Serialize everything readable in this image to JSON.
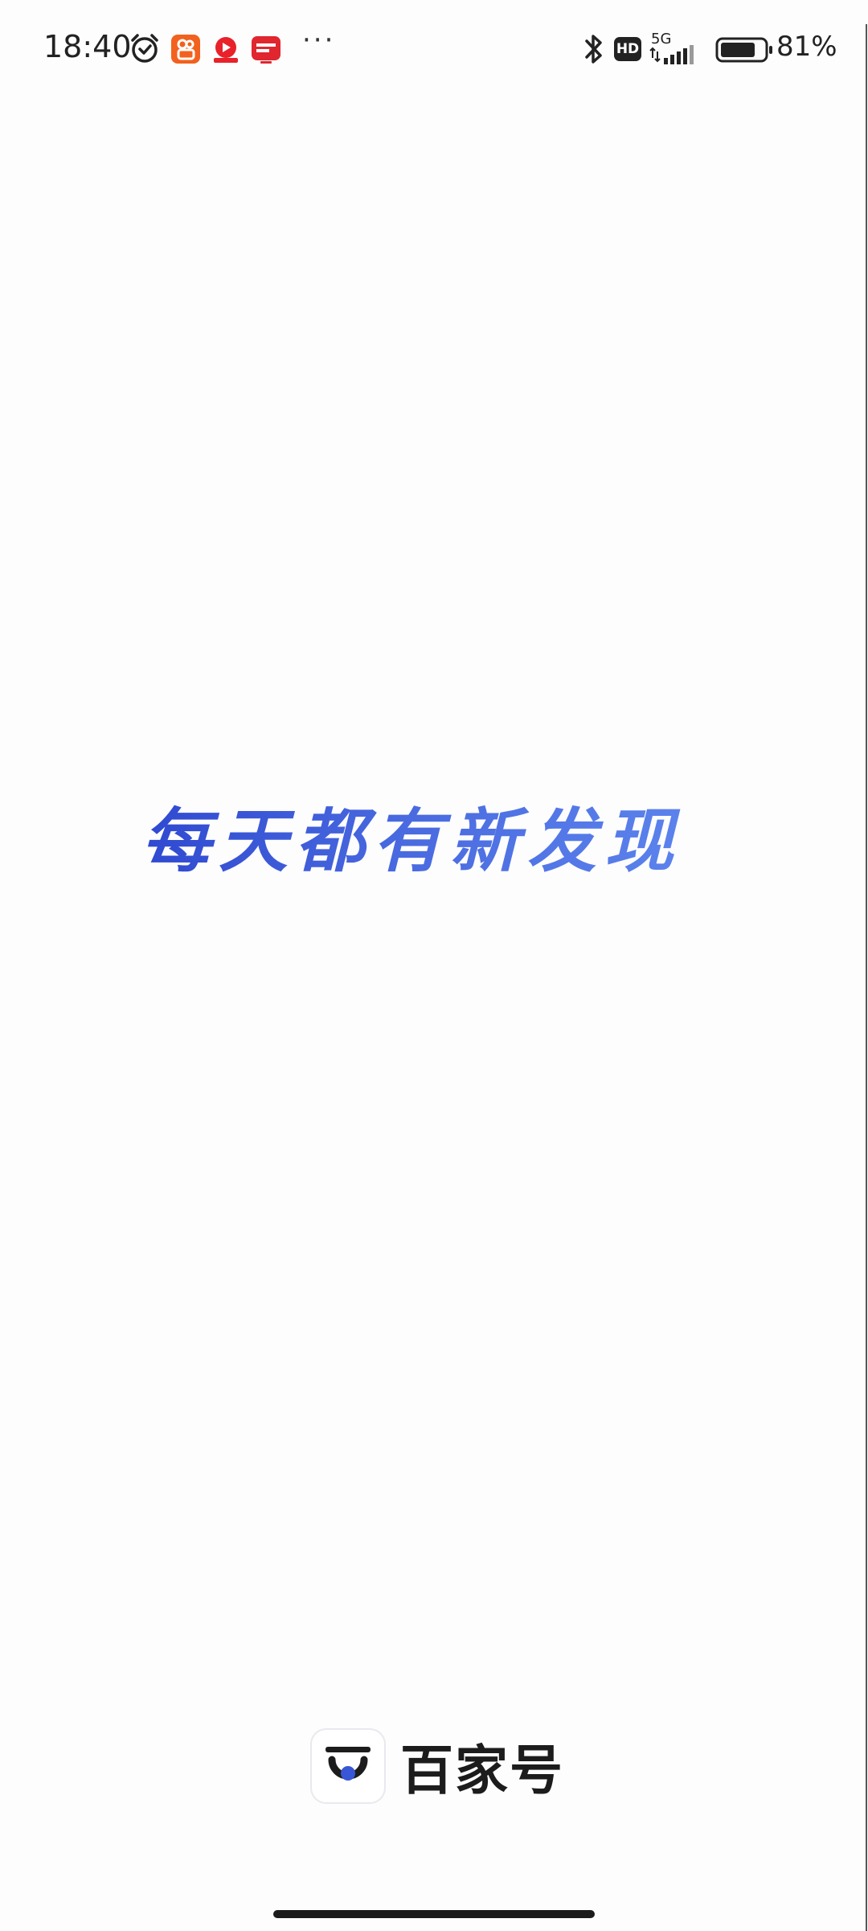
{
  "status_bar": {
    "time": "18:40",
    "more": "···",
    "network": "5G",
    "hd_badge": "HD",
    "battery_percent_text": "81%",
    "battery_level": 0.81,
    "icons": [
      "alarm-icon",
      "app-notification-icon-orange",
      "app-notification-icon-video",
      "app-notification-icon-news",
      "bluetooth-icon",
      "hd-icon",
      "signal-icon",
      "battery-icon"
    ]
  },
  "splash": {
    "slogan": "每天都有新发现"
  },
  "brand": {
    "name": "百家号",
    "accent_color": "#2f49d0"
  }
}
